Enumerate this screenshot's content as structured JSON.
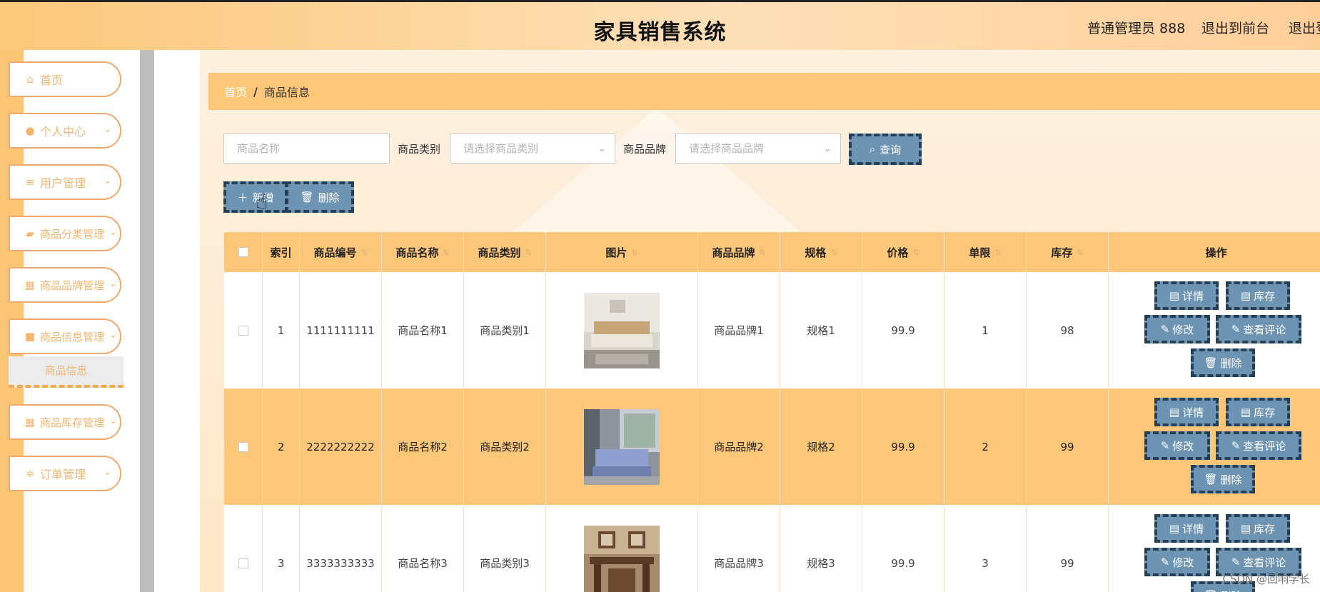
{
  "header": {
    "title": "家具销售系统",
    "user": "普通管理员 888",
    "to_frontend": "退出到前台",
    "logout": "退出登"
  },
  "sidebar": {
    "items": [
      {
        "icon": "home-icon",
        "label": "首页"
      },
      {
        "icon": "user-icon",
        "label": "个人中心"
      },
      {
        "icon": "list-icon",
        "label": "用户管理"
      },
      {
        "icon": "thumb-icon",
        "label": "商品分类管理"
      },
      {
        "icon": "grid-icon",
        "label": "商品品牌管理"
      },
      {
        "icon": "chat-icon",
        "label": "商品信息管理"
      },
      {
        "icon": "grid-icon",
        "label": "商品库存管理"
      },
      {
        "icon": "sliders-icon",
        "label": "订单管理"
      }
    ],
    "submenu_active": "商品信息"
  },
  "breadcrumb": {
    "home": "首页",
    "separator": "/",
    "current": "商品信息"
  },
  "search": {
    "name_placeholder": "商品名称",
    "category_label": "商品类别",
    "category_placeholder": "请选择商品类别",
    "brand_label": "商品品牌",
    "brand_placeholder": "请选择商品品牌",
    "query_button": "查询"
  },
  "toolbar": {
    "add": "新增",
    "delete": "删除"
  },
  "table": {
    "headers": [
      "索引",
      "商品编号",
      "商品名称",
      "商品类别",
      "图片",
      "商品品牌",
      "规格",
      "价格",
      "单限",
      "库存",
      "操作"
    ],
    "rows": [
      {
        "index": "1",
        "code": "1111111111",
        "name": "商品名称1",
        "category": "商品类别1",
        "brand": "商品品牌1",
        "spec": "规格1",
        "price": "99.9",
        "limit": "1",
        "stock": "98"
      },
      {
        "index": "2",
        "code": "2222222222",
        "name": "商品名称2",
        "category": "商品类别2",
        "brand": "商品品牌2",
        "spec": "规格2",
        "price": "99.9",
        "limit": "2",
        "stock": "99"
      },
      {
        "index": "3",
        "code": "3333333333",
        "name": "商品名称3",
        "category": "商品类别3",
        "brand": "商品品牌3",
        "spec": "规格3",
        "price": "99.9",
        "limit": "3",
        "stock": "99"
      }
    ],
    "ops": {
      "detail": "详情",
      "stock": "库存",
      "edit": "修改",
      "comments": "查看评论",
      "delete": "删除"
    }
  },
  "watermark": "CSDN @回响学长",
  "colors": {
    "accent": "#fcc778",
    "button": "#6d95b3",
    "button_border": "#253f57",
    "menu_text": "#f4b56f"
  }
}
